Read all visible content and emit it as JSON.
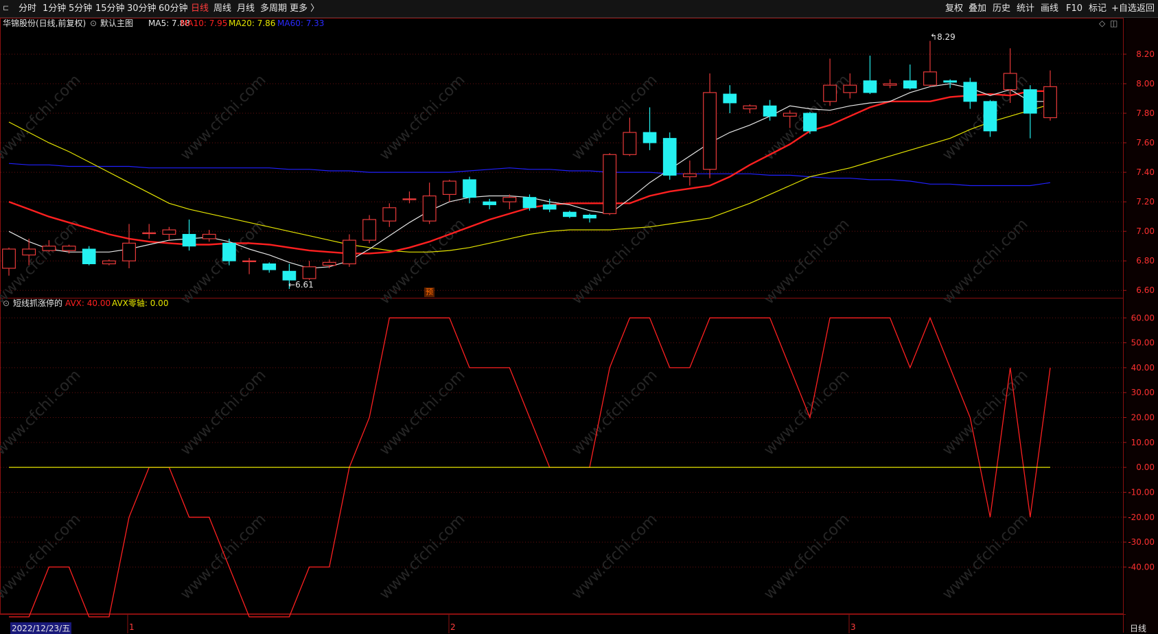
{
  "toolbar": {
    "left_items": [
      "分时",
      "1分钟",
      "5分钟",
      "15分钟",
      "30分钟",
      "60分钟",
      "日线",
      "周线",
      "月线",
      "多周期",
      "更多 〉"
    ],
    "active": "日线",
    "right_items": [
      "复权",
      "叠加",
      "历史",
      "统计",
      "画线",
      "F10",
      "标记",
      "+自选",
      "返回"
    ]
  },
  "main_panel": {
    "stock_name": "华锦股份(日线,前复权)",
    "template": "默认主图",
    "ma5": "MA5: 7.88",
    "ma10": "MA10: 7.95",
    "ma20": "MA20: 7.86",
    "ma60": "MA60: 7.33",
    "high_label": "8.29",
    "low_label": "6.61",
    "preview_badge": "预"
  },
  "sub_panel": {
    "indicator": "短线抓涨停的",
    "avx": "AVX: 40.00",
    "avx_zero": "AVX零轴: 0.00"
  },
  "bottom": {
    "date": "2022/12/23/五",
    "months": [
      "1",
      "2",
      "3"
    ],
    "period": "日线"
  },
  "watermark": "www.cfchi.com",
  "colors": {
    "up": "#e83a3a",
    "down": "#24f0f0",
    "ma5": "#e6e6e6",
    "ma10": "#ff2020",
    "ma20": "#e6e600",
    "ma60": "#2020ff",
    "avx": "#ff2020",
    "zero": "#e6e600"
  },
  "chart_data": [
    {
      "type": "candlestick",
      "y_ticks": [
        "8.20",
        "8.00",
        "7.80",
        "7.60",
        "7.40",
        "7.20",
        "7.00",
        "6.80",
        "6.60"
      ],
      "ylim": [
        6.55,
        8.33
      ],
      "candles": [
        [
          6.75,
          6.88,
          6.7,
          6.89
        ],
        [
          6.84,
          6.88,
          6.77,
          6.95
        ],
        [
          6.87,
          6.9,
          6.86,
          6.94
        ],
        [
          6.87,
          6.9,
          6.85,
          6.91
        ],
        [
          6.88,
          6.78,
          6.77,
          6.9
        ],
        [
          6.78,
          6.8,
          6.77,
          6.81
        ],
        [
          6.8,
          6.92,
          6.75,
          7.05
        ],
        [
          6.99,
          6.99,
          6.95,
          7.05
        ],
        [
          6.98,
          7.01,
          6.94,
          7.03
        ],
        [
          6.98,
          6.9,
          6.87,
          7.08
        ],
        [
          6.95,
          6.98,
          6.93,
          7.01
        ],
        [
          6.92,
          6.8,
          6.77,
          6.95
        ],
        [
          6.8,
          6.8,
          6.71,
          6.82
        ],
        [
          6.78,
          6.74,
          6.72,
          6.79
        ],
        [
          6.73,
          6.67,
          6.61,
          6.78
        ],
        [
          6.68,
          6.76,
          6.67,
          6.8
        ],
        [
          6.77,
          6.79,
          6.75,
          6.81
        ],
        [
          6.78,
          6.94,
          6.76,
          6.98
        ],
        [
          6.94,
          7.08,
          6.92,
          7.11
        ],
        [
          7.07,
          7.16,
          7.03,
          7.19
        ],
        [
          7.22,
          7.22,
          7.19,
          7.27
        ],
        [
          7.07,
          7.24,
          7.05,
          7.33
        ],
        [
          7.25,
          7.34,
          7.2,
          7.35
        ],
        [
          7.35,
          7.23,
          7.19,
          7.37
        ],
        [
          7.2,
          7.18,
          7.15,
          7.22
        ],
        [
          7.2,
          7.23,
          7.15,
          7.25
        ],
        [
          7.23,
          7.16,
          7.14,
          7.25
        ],
        [
          7.18,
          7.15,
          7.13,
          7.22
        ],
        [
          7.13,
          7.1,
          7.09,
          7.14
        ],
        [
          7.11,
          7.09,
          7.06,
          7.12
        ],
        [
          7.12,
          7.52,
          7.11,
          7.53
        ],
        [
          7.52,
          7.67,
          7.51,
          7.77
        ],
        [
          7.67,
          7.6,
          7.55,
          7.84
        ],
        [
          7.63,
          7.38,
          7.35,
          7.67
        ],
        [
          7.37,
          7.39,
          7.31,
          7.48
        ],
        [
          7.42,
          7.94,
          7.36,
          8.07
        ],
        [
          7.93,
          7.87,
          7.8,
          7.99
        ],
        [
          7.83,
          7.85,
          7.8,
          7.86
        ],
        [
          7.85,
          7.78,
          7.75,
          7.89
        ],
        [
          7.78,
          7.8,
          7.7,
          7.82
        ],
        [
          7.8,
          7.68,
          7.66,
          7.81
        ],
        [
          7.88,
          7.99,
          7.85,
          8.17
        ],
        [
          7.94,
          7.99,
          7.9,
          8.07
        ],
        [
          8.02,
          7.94,
          7.93,
          8.19
        ],
        [
          7.99,
          8.0,
          7.97,
          8.03
        ],
        [
          8.02,
          7.97,
          7.96,
          8.13
        ],
        [
          7.99,
          8.08,
          7.98,
          8.29
        ],
        [
          8.02,
          8.01,
          7.97,
          8.03
        ],
        [
          8.01,
          7.88,
          7.83,
          8.04
        ],
        [
          7.88,
          7.68,
          7.64,
          7.89
        ],
        [
          7.96,
          8.07,
          7.87,
          8.24
        ],
        [
          7.96,
          7.8,
          7.63,
          7.99
        ],
        [
          7.77,
          7.98,
          7.75,
          8.09
        ]
      ],
      "ma5": [
        7.0,
        6.93,
        6.88,
        6.86,
        6.86,
        6.86,
        6.88,
        6.91,
        6.94,
        6.95,
        6.96,
        6.93,
        6.88,
        6.84,
        6.79,
        6.75,
        6.76,
        6.8,
        6.88,
        6.97,
        7.06,
        7.14,
        7.2,
        7.23,
        7.24,
        7.24,
        7.23,
        7.2,
        7.18,
        7.14,
        7.12,
        7.22,
        7.33,
        7.42,
        7.51,
        7.6,
        7.67,
        7.72,
        7.78,
        7.85,
        7.83,
        7.82,
        7.85,
        7.87,
        7.88,
        7.94,
        7.98,
        8.0,
        7.97,
        7.92,
        7.96,
        7.88,
        7.88
      ],
      "ma10": [
        7.2,
        7.15,
        7.1,
        7.06,
        7.02,
        6.98,
        6.95,
        6.93,
        6.92,
        6.91,
        6.91,
        6.92,
        6.92,
        6.91,
        6.89,
        6.87,
        6.86,
        6.85,
        6.85,
        6.86,
        6.89,
        6.93,
        6.98,
        7.03,
        7.08,
        7.12,
        7.16,
        7.18,
        7.19,
        7.19,
        7.19,
        7.19,
        7.24,
        7.27,
        7.29,
        7.31,
        7.37,
        7.45,
        7.52,
        7.59,
        7.68,
        7.72,
        7.78,
        7.84,
        7.88,
        7.88,
        7.88,
        7.91,
        7.92,
        7.93,
        7.92,
        7.95,
        7.95
      ],
      "ma20": [
        7.74,
        7.67,
        7.6,
        7.54,
        7.47,
        7.4,
        7.33,
        7.26,
        7.19,
        7.15,
        7.12,
        7.09,
        7.06,
        7.03,
        7.0,
        6.97,
        6.94,
        6.91,
        6.89,
        6.87,
        6.86,
        6.86,
        6.87,
        6.89,
        6.92,
        6.95,
        6.98,
        7.0,
        7.01,
        7.01,
        7.01,
        7.02,
        7.03,
        7.05,
        7.07,
        7.09,
        7.14,
        7.19,
        7.25,
        7.31,
        7.37,
        7.4,
        7.43,
        7.47,
        7.51,
        7.55,
        7.59,
        7.63,
        7.69,
        7.74,
        7.78,
        7.82,
        7.86
      ],
      "ma60": [
        7.46,
        7.45,
        7.45,
        7.44,
        7.44,
        7.44,
        7.44,
        7.43,
        7.43,
        7.43,
        7.43,
        7.43,
        7.43,
        7.43,
        7.42,
        7.42,
        7.41,
        7.41,
        7.4,
        7.4,
        7.4,
        7.4,
        7.4,
        7.41,
        7.42,
        7.43,
        7.42,
        7.42,
        7.41,
        7.41,
        7.4,
        7.4,
        7.4,
        7.39,
        7.39,
        7.39,
        7.39,
        7.39,
        7.38,
        7.38,
        7.37,
        7.36,
        7.36,
        7.35,
        7.35,
        7.34,
        7.32,
        7.32,
        7.31,
        7.31,
        7.31,
        7.31,
        7.33
      ]
    },
    {
      "type": "line",
      "y_ticks": [
        "60.00",
        "50.00",
        "40.00",
        "30.00",
        "20.00",
        "10.00",
        "0.00",
        "-10.00",
        "-20.00",
        "-30.00",
        "-40.00"
      ],
      "ylim": [
        -60,
        62
      ],
      "series": [
        {
          "name": "AVX",
          "values": [
            -60,
            -60,
            -40,
            -40,
            -60,
            -60,
            -20,
            0,
            0,
            -20,
            -20,
            -40,
            -60,
            -60,
            -60,
            -40,
            -40,
            0,
            20,
            60,
            60,
            60,
            60,
            40,
            40,
            40,
            20,
            0,
            0,
            0,
            40,
            60,
            60,
            40,
            40,
            60,
            60,
            60,
            60,
            40,
            20,
            60,
            60,
            60,
            60,
            40,
            60,
            40,
            20,
            -20,
            40,
            -20,
            40
          ]
        },
        {
          "name": "AVX零轴",
          "values": [
            0,
            0,
            0,
            0,
            0,
            0,
            0,
            0,
            0,
            0,
            0,
            0,
            0,
            0,
            0,
            0,
            0,
            0,
            0,
            0,
            0,
            0,
            0,
            0,
            0,
            0,
            0,
            0,
            0,
            0,
            0,
            0,
            0,
            0,
            0,
            0,
            0,
            0,
            0,
            0,
            0,
            0,
            0,
            0,
            0,
            0,
            0,
            0,
            0,
            0,
            0,
            0,
            0
          ]
        }
      ]
    }
  ]
}
